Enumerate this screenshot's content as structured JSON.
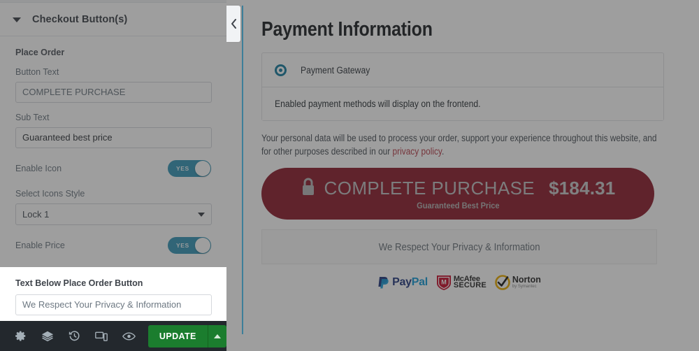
{
  "editor": {
    "header": {
      "title": "Checkout Button(s)",
      "caret_icon": "caret-down-icon"
    },
    "section_label": "Place Order",
    "fields": {
      "button_text": {
        "label": "Button Text",
        "value": "COMPLETE PURCHASE"
      },
      "sub_text": {
        "label": "Sub Text",
        "value": "Guaranteed best price"
      },
      "enable_icon": {
        "label": "Enable Icon",
        "toggle_state": "YES"
      },
      "icons_style": {
        "label": "Select Icons Style",
        "value": "Lock 1"
      },
      "enable_price": {
        "label": "Enable Price",
        "toggle_state": "YES"
      },
      "text_below": {
        "label": "Text Below Place Order Button",
        "value": "We Respect Your Privacy & Information"
      }
    },
    "toolbar": {
      "icons": [
        {
          "name": "settings-gear-icon"
        },
        {
          "name": "navigator-layers-icon"
        },
        {
          "name": "history-clock-icon"
        },
        {
          "name": "responsive-mode-icon"
        },
        {
          "name": "preview-eye-icon"
        }
      ],
      "update_label": "UPDATE",
      "update_caret_icon": "caret-up-icon"
    },
    "collapse_icon": "chevron-left-icon"
  },
  "preview": {
    "title": "Payment Information",
    "gateway": {
      "option_label": "Payment Gateway",
      "selected": true
    },
    "gateway_note": "Enabled payment methods will display on the frontend.",
    "privacy_paragraph": {
      "part1": "Your personal data will be used to process your order, support your experience throughout this website, and for other purposes described in our ",
      "link": "privacy policy",
      "part2": "."
    },
    "purchase_button": {
      "lock_icon": "lock-icon",
      "label": "COMPLETE PURCHASE",
      "price": "$184.31",
      "sub_label": "Guaranteed Best Price"
    },
    "privacy_strip_text": "We Respect Your Privacy & Information",
    "badges": [
      {
        "name": "paypal-badge",
        "text_a": "Pay",
        "text_b": "Pal"
      },
      {
        "name": "mcafee-secure-badge",
        "line1": "McAfee",
        "line2": "SECURE"
      },
      {
        "name": "norton-badge",
        "line1": "Norton",
        "line2": "by Symantec"
      }
    ]
  },
  "colors": {
    "toggle_on": "#3998b8",
    "update_green": "#1b7d2e",
    "purchase_red": "#8e2030",
    "link_red": "#b7414d",
    "radio_blue": "#1a7fa0",
    "accent_line": "#3d7f99"
  }
}
